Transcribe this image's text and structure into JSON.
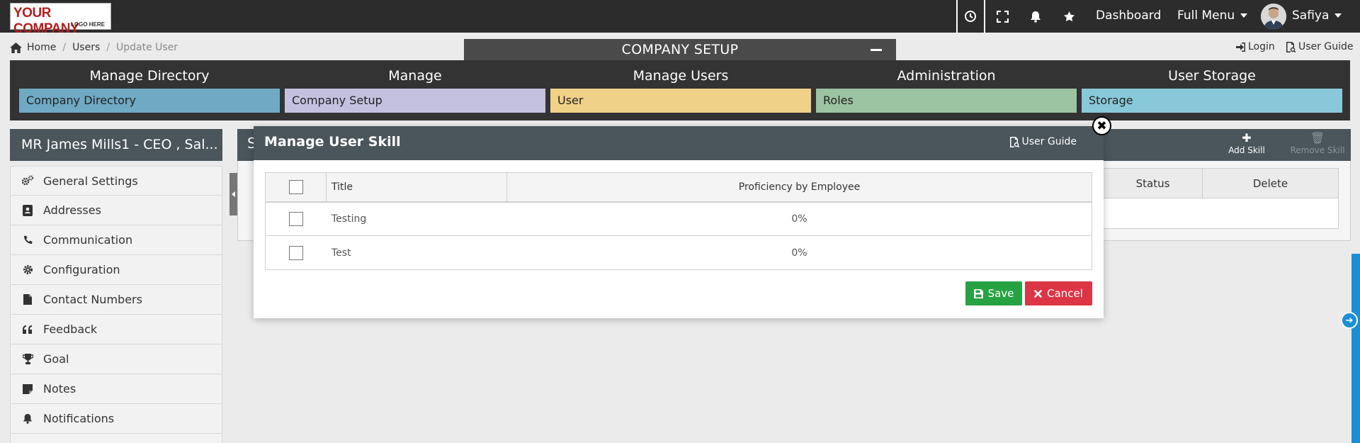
{
  "topbar": {
    "logo_main": "YOUR COMPANY",
    "logo_sub": "LOGO HERE",
    "icons": [
      "clock-icon",
      "fullscreen-icon",
      "bell-icon",
      "star-icon"
    ],
    "dashboard": "Dashboard",
    "full_menu": "Full Menu",
    "username": "Safiya"
  },
  "breadcrumb": {
    "home": "Home",
    "users": "Users",
    "current": "Update User"
  },
  "setup_title": "COMPANY SETUP",
  "header_links": {
    "login": "Login",
    "user_guide": "User Guide"
  },
  "categories": [
    {
      "head": "Manage Directory",
      "item": "Company Directory",
      "color": "#6fa9c3"
    },
    {
      "head": "Manage",
      "item": "Company Setup",
      "color": "#c4c1e0"
    },
    {
      "head": "Manage Users",
      "item": "User",
      "color": "#f0d188"
    },
    {
      "head": "Administration",
      "item": "Roles",
      "color": "#9cc3a2"
    },
    {
      "head": "User Storage",
      "item": "Storage",
      "color": "#88c8d8"
    }
  ],
  "user_panel": {
    "name": "MR James Mills1 - CEO , Sal...",
    "menu": [
      {
        "label": "General Settings",
        "icon": "gears-icon"
      },
      {
        "label": "Addresses",
        "icon": "address-book-icon"
      },
      {
        "label": "Communication",
        "icon": "phone-icon"
      },
      {
        "label": "Configuration",
        "icon": "gear-icon"
      },
      {
        "label": "Contact Numbers",
        "icon": "file-icon"
      },
      {
        "label": "Feedback",
        "icon": "quote-icon"
      },
      {
        "label": "Goal",
        "icon": "trophy-icon"
      },
      {
        "label": "Notes",
        "icon": "sticky-note-icon"
      },
      {
        "label": "Notifications",
        "icon": "bell-icon"
      }
    ]
  },
  "bg_panel": {
    "header_letter": "S",
    "add_skill": "Add Skill",
    "remove_skill": "Remove Skill",
    "col_status": "Status",
    "col_delete": "Delete"
  },
  "modal": {
    "title": "Manage User Skill",
    "user_guide": "User Guide",
    "columns": {
      "title": "Title",
      "proficiency": "Proficiency by Employee"
    },
    "rows": [
      {
        "title": "Testing",
        "proficiency": "0%"
      },
      {
        "title": "Test",
        "proficiency": "0%"
      }
    ],
    "save": "Save",
    "cancel": "Cancel"
  }
}
